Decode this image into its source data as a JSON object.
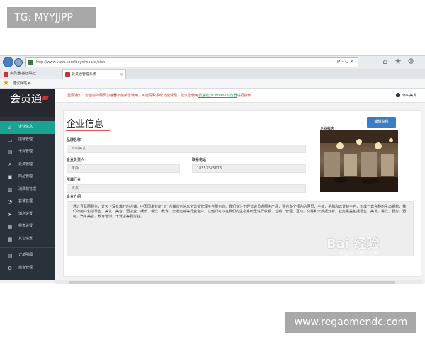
{
  "overlay": {
    "top_tag": "TG: MYYJJPP",
    "bottom_tag": "www.regaomendc.com"
  },
  "browser": {
    "url": "http://www.vietu.com/beyn/web/cl/sian",
    "url_controls": "P - C X",
    "tabs": [
      {
        "label": "会员通-搬运联社"
      },
      {
        "label": "会员通管理系统"
      }
    ],
    "favorites_label": "建议网站 ▾",
    "toolbar_icons": [
      "home-icon",
      "star-icon",
      "gear-icon"
    ]
  },
  "app": {
    "logo": "会员通",
    "notice": {
      "text": "重要通知：您当前的网页加速器不能被您使用，可能导致系统功能受限，建议您使用",
      "link": "极速模式Chrome浏览器",
      "tail": "进行操作"
    },
    "user_label": "坏叫美发",
    "sidebar": {
      "items": [
        {
          "label": "企业信息",
          "icon": "home-icon",
          "active": true
        },
        {
          "label": "店铺管理",
          "icon": "store-icon"
        },
        {
          "label": "卡片管理",
          "icon": "card-icon"
        },
        {
          "label": "会员管理",
          "icon": "user-icon"
        },
        {
          "label": "商品管理",
          "icon": "box-icon"
        },
        {
          "label": "消费积管理",
          "icon": "bars-icon"
        },
        {
          "label": "套餐管理",
          "icon": "gauge-icon"
        },
        {
          "label": "消息设置",
          "icon": "send-icon"
        },
        {
          "label": "报表设置",
          "icon": "chart-icon"
        },
        {
          "label": "其它设置",
          "icon": "grid-icon"
        }
      ],
      "bottom_items": [
        {
          "label": "订单明细",
          "icon": "list-icon"
        },
        {
          "label": "后台管理",
          "icon": "cog-icon"
        }
      ]
    },
    "page": {
      "title": "企业信息",
      "edit_button": "编辑资料",
      "fields": {
        "brand_label": "品牌名称",
        "brand_value": "坏叫美发",
        "owner_label": "企业负责人",
        "owner_value": "朱静",
        "phone_label": "联系电话",
        "phone_value": "18552345678",
        "industry_label": "所属行业",
        "industry_value": "美发",
        "logo_label": "企业标志",
        "intro_label": "企业介绍",
        "intro_text": "通过互联网服务，让天下没有难开的店铺。中国国家智能“云”店铺商务信息化营销管理平台服务商。我们专注于经营会员通服务产品，整合多个领先的网页，平板，手机和云计算平台，形成一套完整的生态系统，我们的用户包括零售、美发、美容、酒店业、娱乐、餐饮、教育、交通运输等行业客户，让他们可以在我们的生态系统里进行收银、营销、管理、互动，交易和大数据分析。业务覆盖包括零售，美发，餐饮，服务，酒吧，汽车美容，教育培训，干洗店等服务业。"
      }
    }
  },
  "watermark": {
    "brand": "Bai 经验",
    "sub": "jingyan.baidu.com"
  },
  "colors": {
    "sidebar_bg": "#2b313a",
    "active_item": "#1aa391",
    "edit_button": "#3b7dc4",
    "title_underline": "#d9534f",
    "notice_red": "#c0392b"
  }
}
